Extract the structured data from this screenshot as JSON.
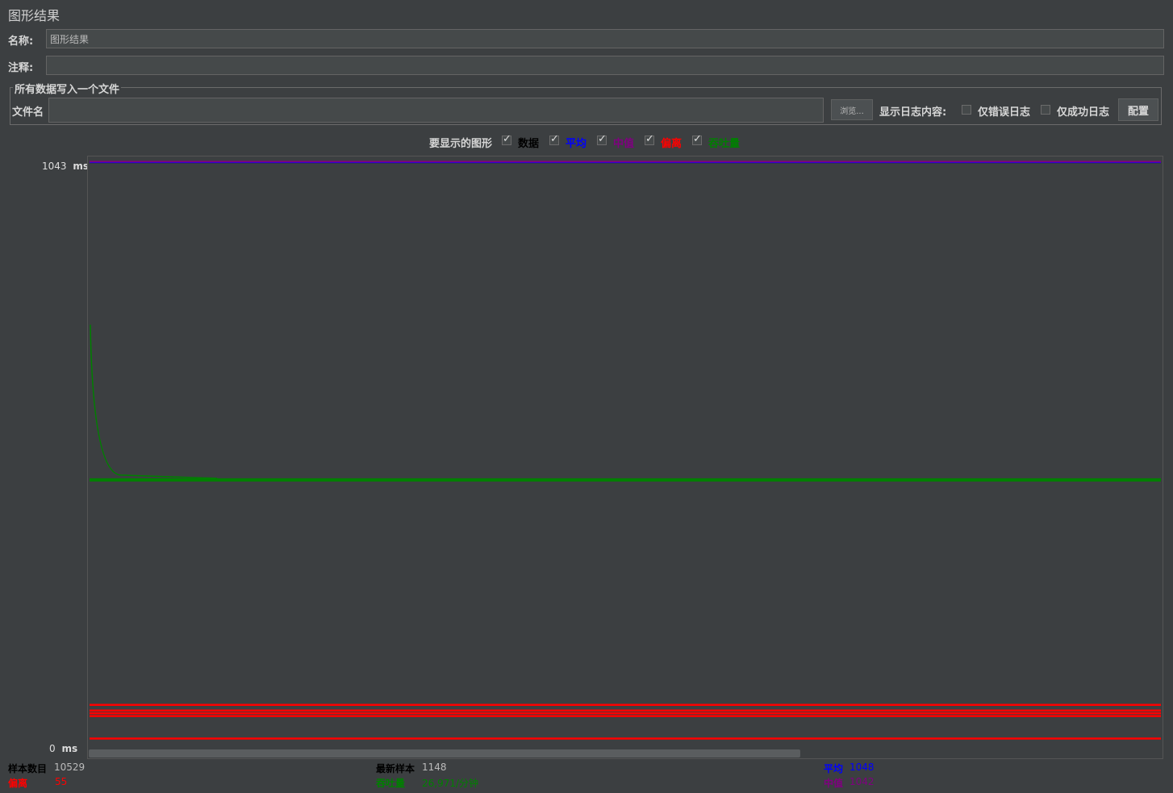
{
  "window": {
    "title": "图形结果"
  },
  "form": {
    "name_label": "名称:",
    "name_value": "图形结果",
    "comment_label": "注释:",
    "comment_value": ""
  },
  "file_group": {
    "legend": "所有数据写入一个文件",
    "filename_label": "文件名",
    "filename_value": "",
    "browse_button": "浏览...",
    "log_content_label": "显示日志内容:",
    "errors_only_label": "仅错误日志",
    "errors_only_checked": false,
    "success_only_label": "仅成功日志",
    "success_only_checked": false,
    "config_button": "配置"
  },
  "graphs_to_display": {
    "label": "要显示的图形",
    "items": [
      {
        "label": "数据",
        "checked": true,
        "color": "#000000"
      },
      {
        "label": "平均",
        "checked": true,
        "color": "#0000ff"
      },
      {
        "label": "中值",
        "checked": true,
        "color": "#800080"
      },
      {
        "label": "偏离",
        "checked": true,
        "color": "#ff0000"
      },
      {
        "label": "吞吐量",
        "checked": true,
        "color": "#008000"
      }
    ]
  },
  "chart_data": {
    "type": "line",
    "y_max_label": "1043",
    "y_min_label": "0",
    "y_unit": "ms",
    "ylim": [
      0,
      1043
    ],
    "series": [
      {
        "name": "数据",
        "color": "#000000",
        "approx_level": 1040
      },
      {
        "name": "平均",
        "color": "#0000ff",
        "approx_level": 1040
      },
      {
        "name": "中值",
        "color": "#800080",
        "approx_level": 1041
      },
      {
        "name": "偏离",
        "color": "#ff0000",
        "levels": [
          75,
          65,
          60,
          55,
          15
        ]
      },
      {
        "name": "吞吐量",
        "color": "#008000",
        "approx_level": 475
      }
    ]
  },
  "stats": {
    "sample_count_label": "样本数目",
    "sample_count_value": "10529",
    "deviation_label": "偏离",
    "deviation_value": "55",
    "latest_sample_label": "最新样本",
    "latest_sample_value": "1148",
    "throughput_label": "吞吐量",
    "throughput_value": "26,971/分钟",
    "average_label": "平均",
    "average_value": "1048",
    "median_label": "中值",
    "median_value": "1042",
    "colors": {
      "sample_count": "#000000",
      "deviation": "#ff0000",
      "latest_sample": "#000000",
      "throughput": "#008000",
      "average": "#0000ff",
      "median": "#800080"
    }
  }
}
